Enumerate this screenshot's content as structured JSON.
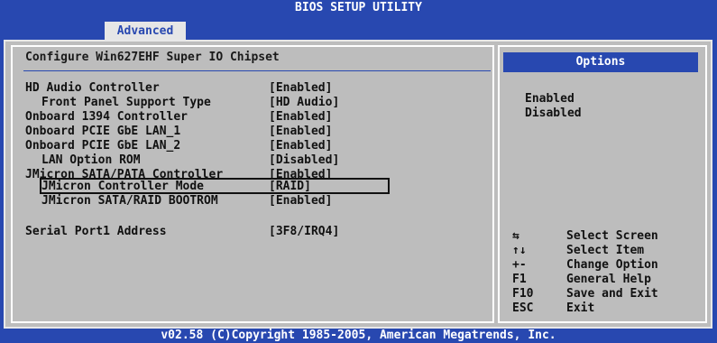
{
  "header": {
    "title": "BIOS SETUP UTILITY",
    "tab": "Advanced"
  },
  "panel": {
    "title": "Configure Win627EHF Super IO Chipset"
  },
  "settings": [
    {
      "label": "HD Audio Controller",
      "value": "[Enabled]"
    },
    {
      "label": "Front Panel Support Type",
      "value": "[HD Audio]"
    },
    {
      "label": "Onboard 1394 Controller",
      "value": "[Enabled]"
    },
    {
      "label": "Onboard PCIE GbE LAN_1",
      "value": "[Enabled]"
    },
    {
      "label": "Onboard PCIE GbE LAN_2",
      "value": "[Enabled]"
    },
    {
      "label": "LAN Option ROM",
      "value": "[Disabled]"
    },
    {
      "label": "JMicron SATA/PATA Controller",
      "value": "[Enabled]"
    },
    {
      "label": "JMicron Controller Mode",
      "value": "[RAID]"
    },
    {
      "label": "JMicron SATA/RAID BOOTROM",
      "value": "[Enabled]"
    },
    {
      "label": "Serial Port1 Address",
      "value": "[3F8/IRQ4]"
    }
  ],
  "options": {
    "title": "Options",
    "items": [
      "Enabled",
      "Disabled"
    ]
  },
  "help": [
    {
      "key": "⇆",
      "desc": "Select Screen"
    },
    {
      "key": "↑↓",
      "desc": "Select Item"
    },
    {
      "key": "+-",
      "desc": "Change Option"
    },
    {
      "key": "F1",
      "desc": "General Help"
    },
    {
      "key": "F10",
      "desc": "Save and Exit"
    },
    {
      "key": "ESC",
      "desc": "Exit"
    }
  ],
  "footer": {
    "text": "v02.58 (C)Copyright 1985-2005, American Megatrends, Inc."
  },
  "colors": {
    "background": "#2848b0",
    "panel": "#bdbdbd",
    "text": "#111111",
    "highlight_text": "#ffffff"
  }
}
